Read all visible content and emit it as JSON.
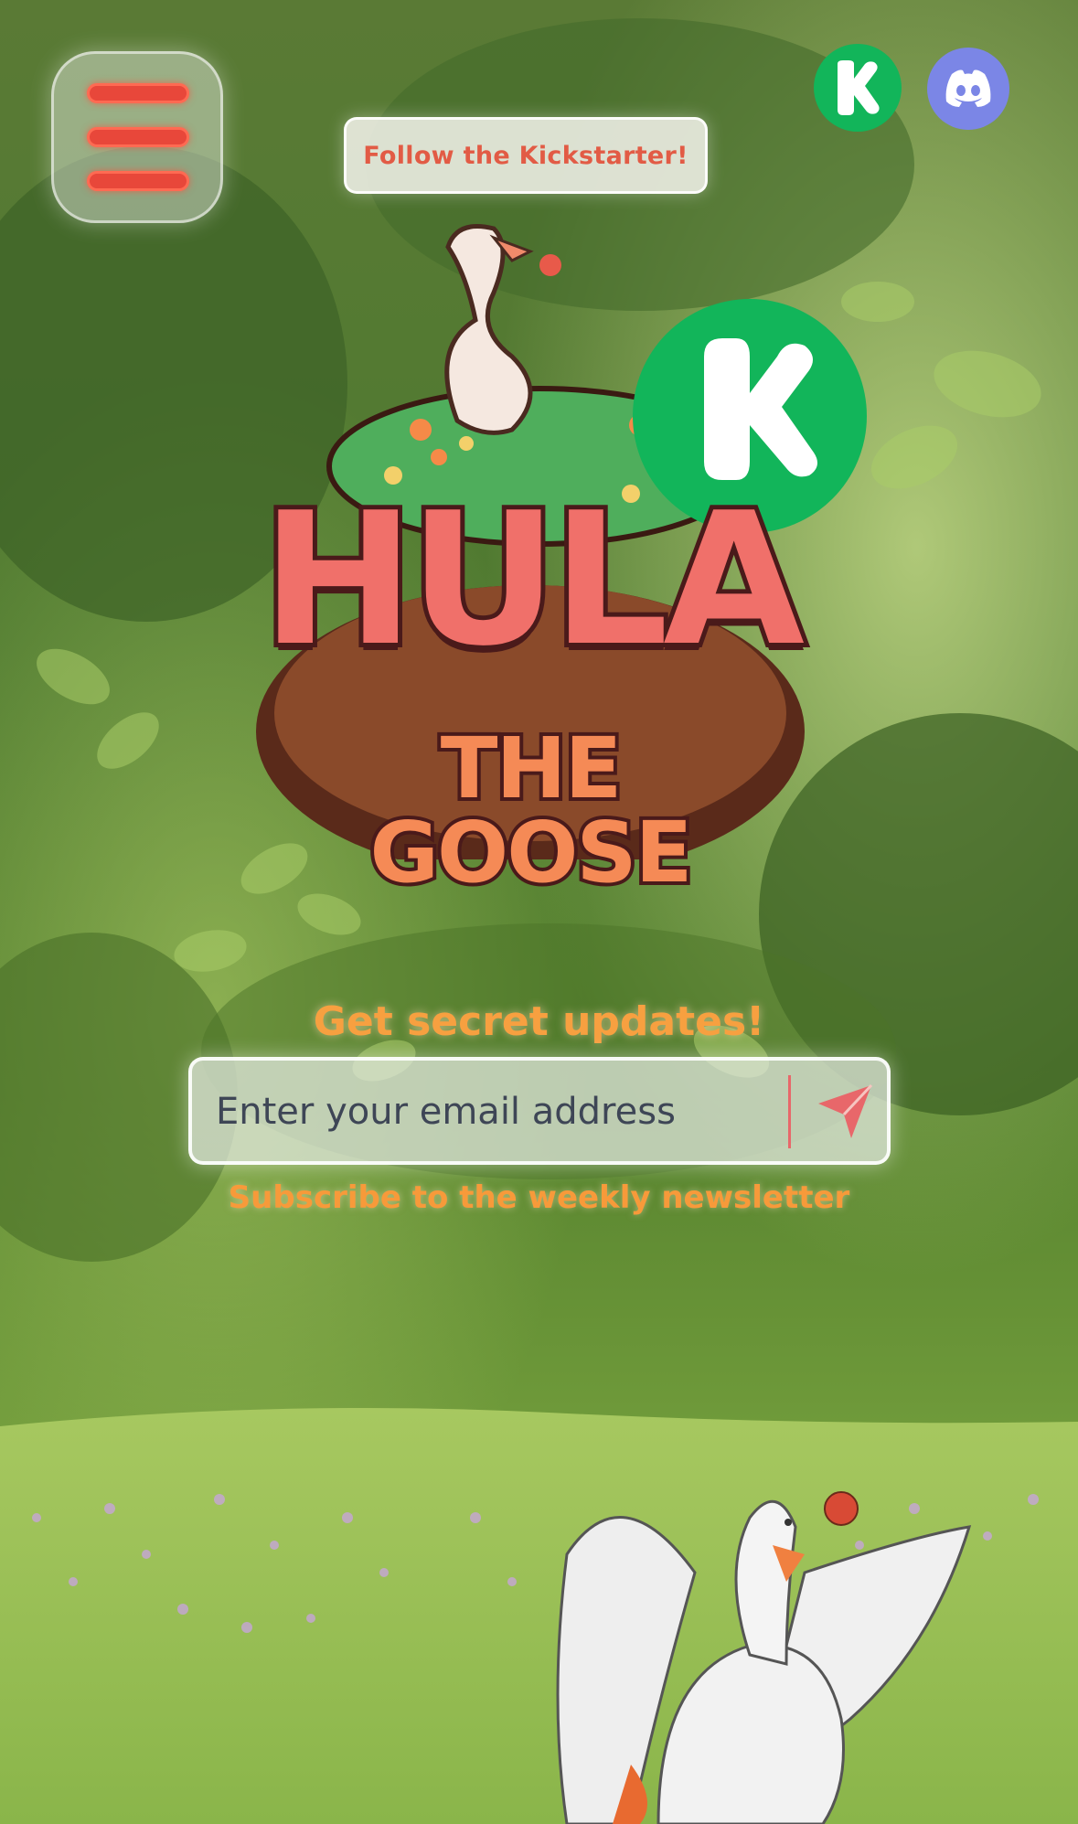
{
  "header": {
    "menu_icon": "hamburger-menu-icon",
    "follow_label": "Follow the Kickstarter!",
    "social": [
      {
        "name": "Kickstarter",
        "icon": "kickstarter-icon",
        "color": "#12b55a"
      },
      {
        "name": "Discord",
        "icon": "discord-icon",
        "color": "#7b86e6"
      }
    ]
  },
  "logo": {
    "title": "HULA",
    "subtitle": "THE GOOSE",
    "badge_icon": "kickstarter-badge-icon"
  },
  "signup": {
    "title": "Get secret updates!",
    "placeholder": "Enter your email address",
    "send_icon": "send-arrow-icon",
    "caption": "Subscribe to the weekly newsletter"
  },
  "colors": {
    "accent": "#e8473a",
    "orange": "#f7a040",
    "kickstarter_green": "#12b55a",
    "discord_blue": "#7b86e6"
  }
}
